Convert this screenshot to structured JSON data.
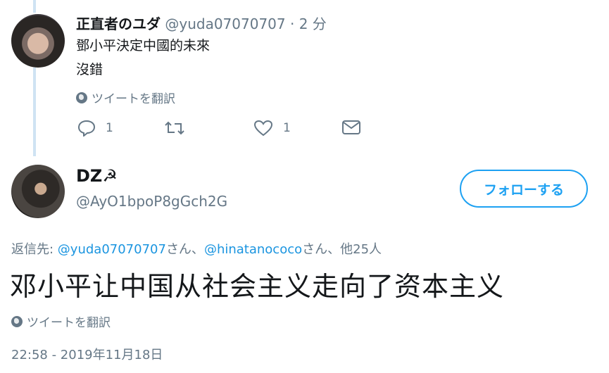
{
  "tweet1": {
    "display_name": "正直者のユダ",
    "handle": "@yuda07070707",
    "separator": "·",
    "time_ago": "2 分",
    "line1": "鄧小平決定中國的未來",
    "line2": "沒錯",
    "translate_label": "ツイートを翻訳",
    "reply_count": "1",
    "like_count": "1"
  },
  "tweet2": {
    "display_name": "DZ☭",
    "handle": "@AyO1bpoP8gGch2G",
    "follow_label": "フォローする",
    "reply_prefix": "返信先: ",
    "mention1": "@yuda07070707",
    "san1": "さん、",
    "mention2": "@hinatanococo",
    "san2": "さん、他25人",
    "text": "邓小平让中国从社会主义走向了资本主义",
    "translate_label": "ツイートを翻訳",
    "timestamp": "22:58 - 2019年11月18日"
  },
  "colors": {
    "accent": "#1da1f2",
    "secondary_text": "#657786",
    "thread_line": "#cfe3f3"
  }
}
